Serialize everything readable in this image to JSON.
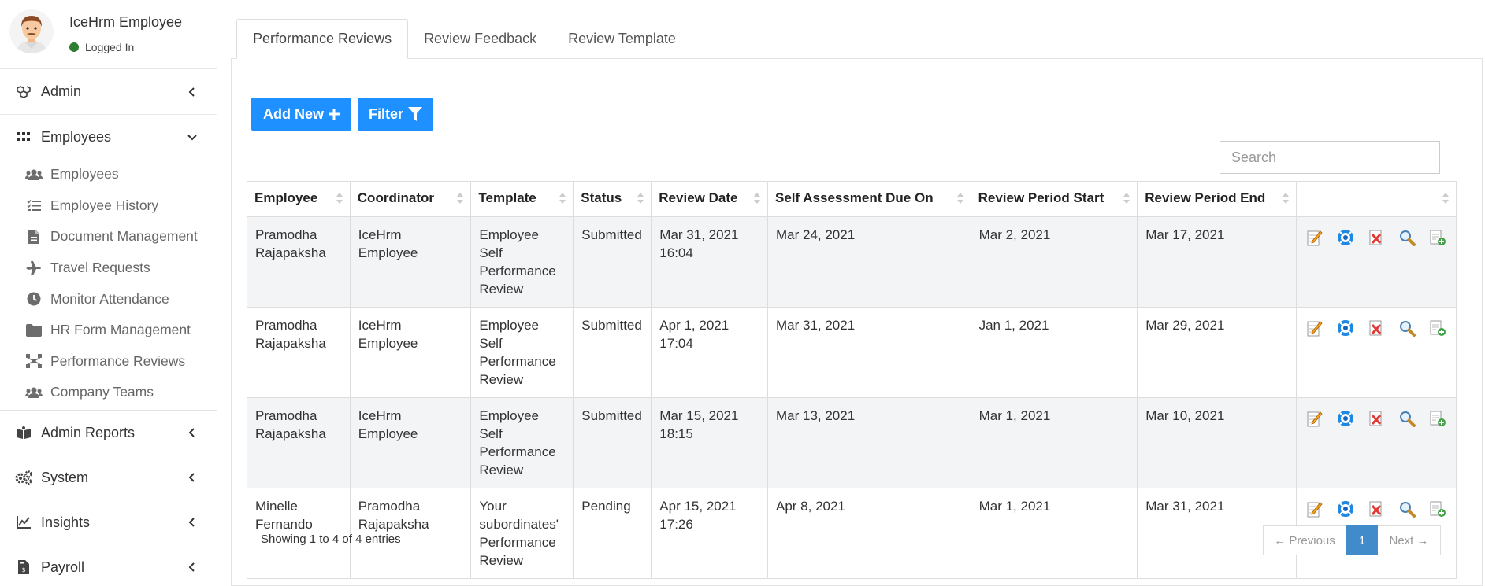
{
  "user": {
    "name": "IceHrm Employee",
    "status": "Logged In"
  },
  "sidebar": {
    "top": [
      {
        "label": "Admin",
        "icon": "cubes-icon"
      }
    ],
    "open": {
      "label": "Employees",
      "icon": "grid-icon"
    },
    "sub": [
      {
        "label": "Employees",
        "icon": "users-icon"
      },
      {
        "label": "Employee History",
        "icon": "list-icon"
      },
      {
        "label": "Document Management",
        "icon": "file-icon"
      },
      {
        "label": "Travel Requests",
        "icon": "plane-icon"
      },
      {
        "label": "Monitor Attendance",
        "icon": "clock-icon"
      },
      {
        "label": "HR Form Management",
        "icon": "folder-icon"
      },
      {
        "label": "Performance Reviews",
        "icon": "sitemap-icon"
      },
      {
        "label": "Company Teams",
        "icon": "users-icon"
      }
    ],
    "bottom": [
      {
        "label": "Admin Reports",
        "icon": "book-icon"
      },
      {
        "label": "System",
        "icon": "gears-icon"
      },
      {
        "label": "Insights",
        "icon": "chart-icon"
      },
      {
        "label": "Payroll",
        "icon": "invoice-icon"
      }
    ]
  },
  "tabs": [
    "Performance Reviews",
    "Review Feedback",
    "Review Template"
  ],
  "toolbar": {
    "add_label": "Add New",
    "filter_label": "Filter"
  },
  "search": {
    "placeholder": "Search"
  },
  "table": {
    "headers": [
      "Employee",
      "Coordinator",
      "Template",
      "Status",
      "Review Date",
      "Self Assessment Due On",
      "Review Period Start",
      "Review Period End",
      ""
    ],
    "rows": [
      [
        "Pramodha Rajapaksha",
        "IceHrm Employee",
        "Employee Self Performance Review",
        "Submitted",
        "Mar 31, 2021 16:04",
        "Mar 24, 2021",
        "Mar 2, 2021",
        "Mar 17, 2021"
      ],
      [
        "Pramodha Rajapaksha",
        "IceHrm Employee",
        "Employee Self Performance Review",
        "Submitted",
        "Apr 1, 2021 17:04",
        "Mar 31, 2021",
        "Jan 1, 2021",
        "Mar 29, 2021"
      ],
      [
        "Pramodha Rajapaksha",
        "IceHrm Employee",
        "Employee Self Performance Review",
        "Submitted",
        "Mar 15, 2021 18:15",
        "Mar 13, 2021",
        "Mar 1, 2021",
        "Mar 10, 2021"
      ],
      [
        "Minelle Fernando",
        "Pramodha Rajapaksha",
        "Your subordinates' Performance Review",
        "Pending",
        "Apr 15, 2021 17:26",
        "Apr 8, 2021",
        "Mar 1, 2021",
        "Mar 31, 2021"
      ]
    ],
    "actions": [
      "edit-icon",
      "feedback-icon",
      "delete-icon",
      "view-icon",
      "copy-icon"
    ]
  },
  "footer": {
    "info": "Showing 1 to 4 of 4 entries",
    "prev": "← Previous",
    "page": "1",
    "next": "Next →"
  }
}
